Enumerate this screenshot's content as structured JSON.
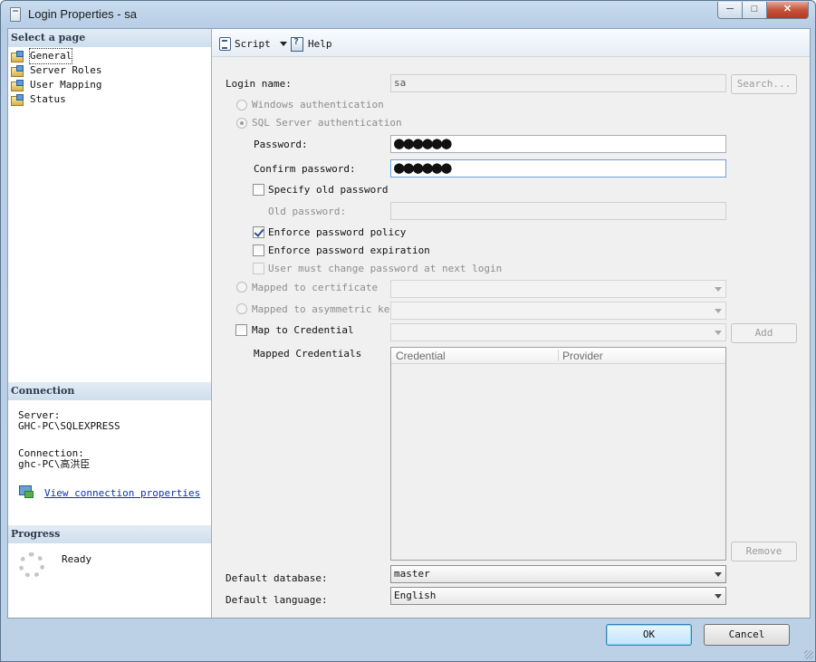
{
  "window": {
    "title": "Login Properties - sa",
    "min": "0",
    "max": "1",
    "close": "r"
  },
  "left": {
    "select_page_header": "Select a page",
    "pages": [
      "General",
      "Server Roles",
      "User Mapping",
      "Status"
    ],
    "connection_header": "Connection",
    "server_label": "Server:",
    "server_value": "GHC-PC\\SQLEXPRESS",
    "connection_label": "Connection:",
    "connection_value": "ghc-PC\\高洪臣",
    "view_link": "View connection properties",
    "progress_header": "Progress",
    "progress_status": "Ready"
  },
  "toolbar": {
    "script": "Script",
    "help": "Help"
  },
  "form": {
    "login_name_label": "Login name:",
    "login_name_value": "sa",
    "search_button": "Search...",
    "windows_auth": "Windows authentication",
    "sql_auth": "SQL Server authentication",
    "password_label": "Password:",
    "password_value": "●●●●●●",
    "confirm_label": "Confirm password:",
    "confirm_value": "●●●●●●",
    "specify_old": "Specify old password",
    "old_password_label": "Old password:",
    "enforce_policy": "Enforce password policy",
    "enforce_expiration": "Enforce password expiration",
    "must_change": "User must change password at next login",
    "mapped_cert": "Mapped to certificate",
    "mapped_asym": "Mapped to asymmetric key",
    "map_credential": "Map to Credential",
    "add_button": "Add",
    "mapped_credentials_label": "Mapped Credentials",
    "grid_columns": [
      "Credential",
      "Provider"
    ],
    "remove_button": "Remove",
    "default_db_label": "Default database:",
    "default_db_value": "master",
    "default_lang_label": "Default language:",
    "default_lang_value": "English"
  },
  "footer": {
    "ok": "OK",
    "cancel": "Cancel"
  },
  "state": {
    "sql_auth_selected": true,
    "enforce_policy_checked": true
  },
  "colors": {
    "link": "#0d2fbd",
    "title_bar": "#c9dcef",
    "close_button": "#c6523a",
    "default_button": "#3c7fb1"
  }
}
